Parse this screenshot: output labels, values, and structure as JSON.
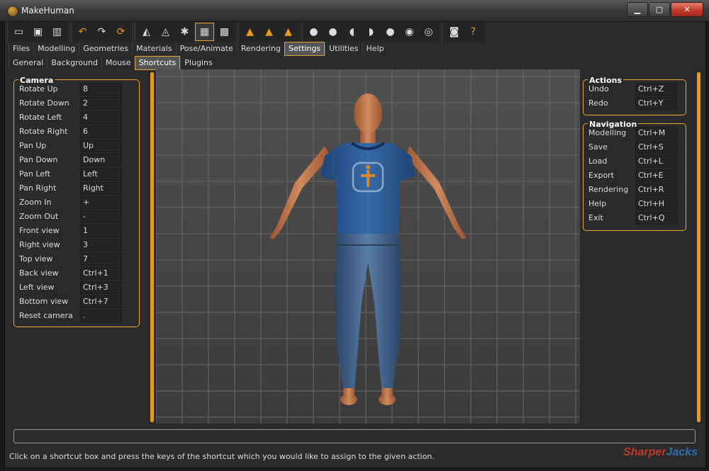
{
  "window": {
    "title": "MakeHuman",
    "min_label": "▁",
    "max_label": "▢",
    "close_label": "✕"
  },
  "toolbar": {
    "groups": [
      [
        {
          "name": "undo-list-icon",
          "glyph": "▭"
        },
        {
          "name": "save-icon",
          "glyph": "▣"
        },
        {
          "name": "export-icon",
          "glyph": "▥"
        }
      ],
      [
        {
          "name": "undo-icon",
          "glyph": "↶",
          "orange": true
        },
        {
          "name": "redo-icon",
          "glyph": "↷"
        },
        {
          "name": "reset-icon",
          "glyph": "⟳",
          "orange": true
        }
      ],
      [
        {
          "name": "smooth-icon",
          "glyph": "◭"
        },
        {
          "name": "wireframe-icon",
          "glyph": "◬"
        },
        {
          "name": "pose-icon",
          "glyph": "✱"
        },
        {
          "name": "grid-icon",
          "glyph": "▦",
          "active": true
        },
        {
          "name": "checker-icon",
          "glyph": "▩"
        }
      ],
      [
        {
          "name": "front-view-icon",
          "glyph": "▲",
          "orange": true
        },
        {
          "name": "side-view-icon",
          "glyph": "▲",
          "orange": true
        },
        {
          "name": "top-view-icon",
          "glyph": "▲",
          "orange": true
        }
      ],
      [
        {
          "name": "head-front-icon",
          "glyph": "●"
        },
        {
          "name": "head-back-icon",
          "glyph": "●"
        },
        {
          "name": "head-left-icon",
          "glyph": "◖"
        },
        {
          "name": "head-right-icon",
          "glyph": "◗"
        },
        {
          "name": "head-top-icon",
          "glyph": "●"
        },
        {
          "name": "head-bottom-icon",
          "glyph": "◉"
        },
        {
          "name": "reset-camera-icon",
          "glyph": "◎"
        }
      ],
      [
        {
          "name": "screenshot-icon",
          "glyph": "◙"
        },
        {
          "name": "help-icon",
          "glyph": "?",
          "orange": true
        }
      ]
    ]
  },
  "main_tabs": [
    {
      "label": "Files",
      "active": false
    },
    {
      "label": "Modelling",
      "active": false
    },
    {
      "label": "Geometries",
      "active": false
    },
    {
      "label": "Materials",
      "active": false
    },
    {
      "label": "Pose/Animate",
      "active": false
    },
    {
      "label": "Rendering",
      "active": false
    },
    {
      "label": "Settings",
      "active": true
    },
    {
      "label": "Utilities",
      "active": false
    },
    {
      "label": "Help",
      "active": false
    }
  ],
  "sub_tabs": [
    {
      "label": "General",
      "active": false
    },
    {
      "label": "Background",
      "active": false
    },
    {
      "label": "Mouse",
      "active": false
    },
    {
      "label": "Shortcuts",
      "active": true
    },
    {
      "label": "Plugins",
      "active": false
    }
  ],
  "camera": {
    "title": "Camera",
    "rows": [
      {
        "label": "Rotate Up",
        "value": "8"
      },
      {
        "label": "Rotate Down",
        "value": "2"
      },
      {
        "label": "Rotate Left",
        "value": "4"
      },
      {
        "label": "Rotate Right",
        "value": "6"
      },
      {
        "label": "Pan Up",
        "value": "Up"
      },
      {
        "label": "Pan Down",
        "value": "Down"
      },
      {
        "label": "Pan Left",
        "value": "Left"
      },
      {
        "label": "Pan Right",
        "value": "Right"
      },
      {
        "label": "Zoom In",
        "value": "+"
      },
      {
        "label": "Zoom Out",
        "value": "-"
      },
      {
        "label": "Front view",
        "value": "1"
      },
      {
        "label": "Right view",
        "value": "3"
      },
      {
        "label": "Top view",
        "value": "7"
      },
      {
        "label": "Back view",
        "value": "Ctrl+1"
      },
      {
        "label": "Left view",
        "value": "Ctrl+3"
      },
      {
        "label": "Bottom view",
        "value": "Ctrl+7"
      },
      {
        "label": "Reset camera",
        "value": "."
      }
    ]
  },
  "actions": {
    "title": "Actions",
    "rows": [
      {
        "label": "Undo",
        "value": "Ctrl+Z"
      },
      {
        "label": "Redo",
        "value": "Ctrl+Y"
      }
    ]
  },
  "navigation": {
    "title": "Navigation",
    "rows": [
      {
        "label": "Modelling",
        "value": "Ctrl+M"
      },
      {
        "label": "Save",
        "value": "Ctrl+S"
      },
      {
        "label": "Load",
        "value": "Ctrl+L"
      },
      {
        "label": "Export",
        "value": "Ctrl+E"
      },
      {
        "label": "Rendering",
        "value": "Ctrl+R"
      },
      {
        "label": "Help",
        "value": "Ctrl+H"
      },
      {
        "label": "Exit",
        "value": "Ctrl+Q"
      }
    ]
  },
  "status": {
    "text": "Click on a shortcut box and press the keys of the shortcut which you would like to assign to the given action."
  },
  "watermark": {
    "part1": "Sharper",
    "part2": "Jacks"
  },
  "colors": {
    "accent": "#e6a629",
    "shirt": "#2f5d9a",
    "skin": "#c77a52",
    "jeans": "#3f5f86"
  }
}
